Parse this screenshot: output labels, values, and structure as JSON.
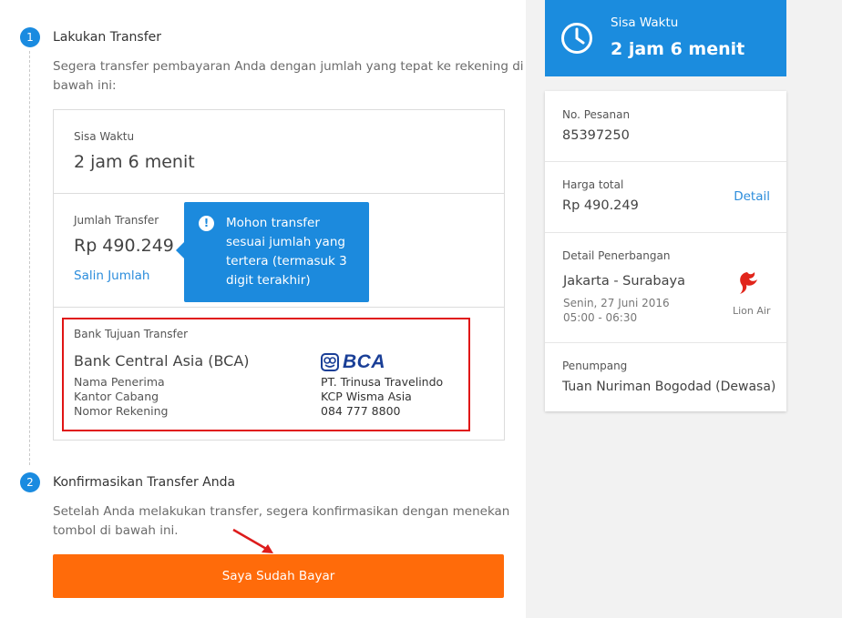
{
  "step1": {
    "number": "1",
    "title": "Lakukan Transfer",
    "description_line1": "Segera transfer pembayaran Anda dengan jumlah yang tepat ke rekening di",
    "description_line2": "bawah ini:"
  },
  "transfer_box": {
    "time_label": "Sisa Waktu",
    "time_value": "2 jam 6 menit",
    "amount_label": "Jumlah Transfer",
    "amount_value": "Rp 490.249",
    "copy_link": "Salin Jumlah"
  },
  "tooltip": {
    "icon": "!",
    "line1": "Mohon transfer",
    "line2": "sesuai jumlah yang",
    "line3": "tertera (termasuk 3",
    "line4": "digit terakhir)"
  },
  "bank": {
    "section_label": "Bank Tujuan Transfer",
    "name": "Bank Central Asia (BCA)",
    "logo_text": "BCA",
    "recipient_label": "Nama Penerima",
    "recipient_value": "PT. Trinusa Travelindo",
    "branch_label": "Kantor Cabang",
    "branch_value": "KCP Wisma Asia",
    "account_label": "Nomor Rekening",
    "account_value": "084 777 8800"
  },
  "step2": {
    "number": "2",
    "title": "Konfirmasikan Transfer Anda",
    "description_line1": "Setelah Anda melakukan transfer, segera konfirmasikan dengan menekan",
    "description_line2": "tombol di bawah ini."
  },
  "pay_button": "Saya Sudah Bayar",
  "timer": {
    "label": "Sisa Waktu",
    "value": "2 jam 6 menit",
    "icon": "clock-icon"
  },
  "summary": {
    "order_label": "No. Pesanan",
    "order_value": "85397250",
    "price_label": "Harga total",
    "price_value": "Rp 490.249",
    "detail_link": "Detail",
    "flight_label": "Detail Penerbangan",
    "route": "Jakarta - Surabaya",
    "date": "Senin, 27 Juni 2016",
    "time": "05:00 - 06:30",
    "airline": "Lion Air",
    "passenger_label": "Penumpang",
    "passenger_value": "Tuan Nuriman Bogodad (Dewasa)"
  },
  "colors": {
    "accent_blue": "#1b8cde",
    "button_orange": "#ff6b0a",
    "highlight_red": "#e01414",
    "arrow_red": "#dd1c1c"
  }
}
